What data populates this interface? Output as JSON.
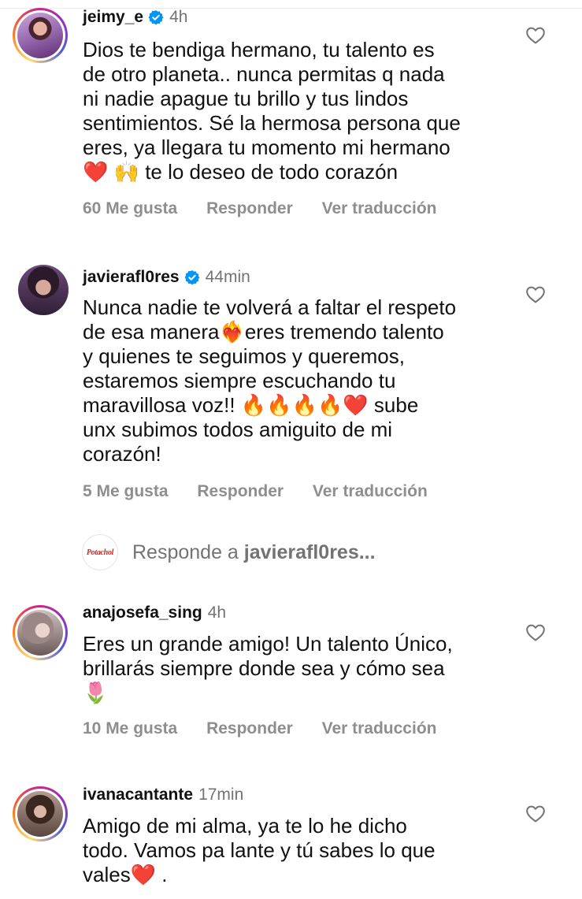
{
  "comments": [
    {
      "username": "jeimy_e",
      "verified": true,
      "time": "4h",
      "text": "Dios te bendiga hermano, tu talento es\nde otro planeta.. nunca permitas q nada\nni nadie apague tu brillo y tus lindos\nsentimientos. Sé la hermosa persona que\neres, ya llegara tu momento mi hermano\n❤️ 🙌 te lo deseo de todo corazón",
      "likes": "60 Me gusta",
      "reply_label": "Responder",
      "translate_label": "Ver traducción"
    },
    {
      "username": "javierafl0res",
      "verified": true,
      "time": "44min",
      "text": "Nunca nadie te volverá a faltar el respeto\nde esa manera❤️‍🔥eres tremendo talento\ny quienes te seguimos y queremos,\nestaremos siempre escuchando tu\nmaravillosa voz!! 🔥🔥🔥🔥❤️ sube\nunx subimos todos amiguito de mi\ncorazón!",
      "likes": "5 Me gusta",
      "reply_label": "Responder",
      "translate_label": "Ver traducción"
    },
    {
      "username": "anajosefa_sing",
      "verified": false,
      "time": "4h",
      "text": "Eres un grande amigo! Un talento Único,\nbrillarás siempre donde sea y cómo sea\n🌷",
      "likes": "10 Me gusta",
      "reply_label": "Responder",
      "translate_label": "Ver traducción"
    },
    {
      "username": "ivanacantante",
      "verified": false,
      "time": "17min",
      "text": "Amigo de mi alma,  ya te lo he dicho\ntodo. Vamos pa lante y tú sabes lo que\nvales❤️ .",
      "likes": "",
      "reply_label": "",
      "translate_label": ""
    }
  ],
  "reply_box": {
    "prefix": "Responde a",
    "target_user": "javierafl0res",
    "suffix": "...",
    "avatar_logo_text": "Potachol"
  },
  "icons": {
    "verified": "verified-badge-icon",
    "like": "heart-outline-icon"
  },
  "colors": {
    "verified_blue": "#0095f6",
    "muted_text": "#737373",
    "action_text": "#8e8e8e",
    "story_ring": "#d62976"
  }
}
